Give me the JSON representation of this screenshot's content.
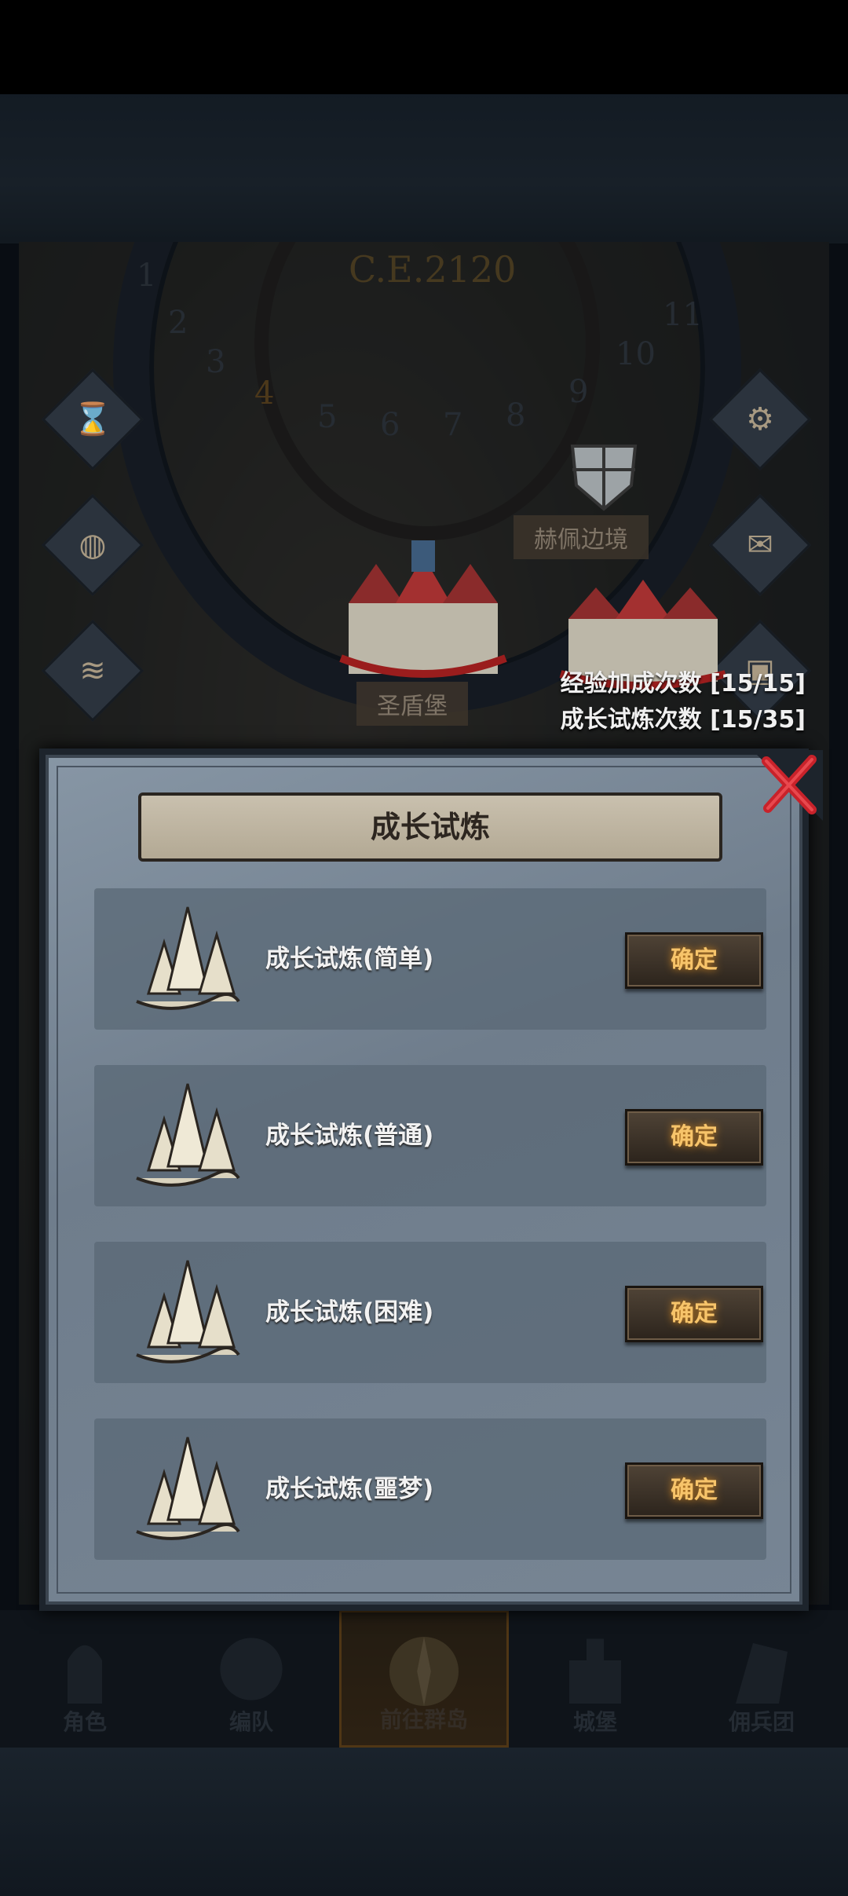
{
  "map": {
    "year": "C.E.2120",
    "dial_numbers": [
      "1",
      "2",
      "3",
      "4",
      "5",
      "6",
      "7",
      "8",
      "9",
      "10",
      "11"
    ],
    "locations": [
      {
        "name": "赫佩边境"
      },
      {
        "name": "圣盾堡"
      }
    ],
    "side_icons": [
      "hourglass-icon",
      "money-bag-icon",
      "scroll-icon",
      "gear-icon",
      "mail-icon",
      "chest-icon"
    ]
  },
  "counters": {
    "exp_bonus": "经验加成次数 [15/15]",
    "growth_trial": "成长试炼次数 [15/35]"
  },
  "dialog": {
    "title": "成长试炼",
    "rows": [
      {
        "label": "成长试炼(简单)",
        "button": "确定"
      },
      {
        "label": "成长试炼(普通)",
        "button": "确定"
      },
      {
        "label": "成长试炼(困难)",
        "button": "确定"
      },
      {
        "label": "成长试炼(噩梦)",
        "button": "确定"
      }
    ]
  },
  "nav": {
    "items": [
      {
        "label": "角色"
      },
      {
        "label": "编队"
      },
      {
        "label": "前往群岛"
      },
      {
        "label": "城堡"
      },
      {
        "label": "佣兵团"
      }
    ]
  },
  "colors": {
    "accent": "#f7c46a",
    "close_red": "#c8222a",
    "modal_bg": "#7d8b9a"
  }
}
